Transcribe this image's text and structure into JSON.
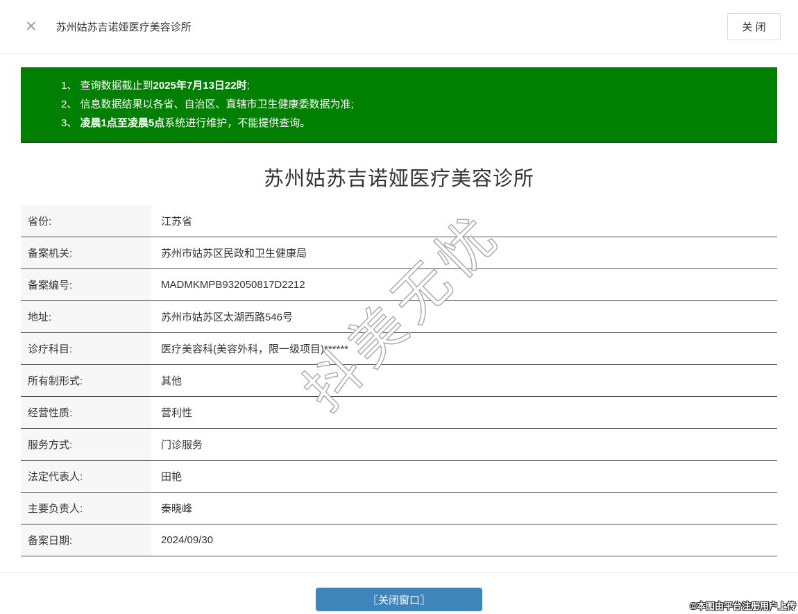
{
  "header": {
    "close_icon": "✕",
    "title": "苏州姑苏吉诺娅医疗美容诊所",
    "close_button_label": "关 闭"
  },
  "notice": {
    "bg_color": "#008000",
    "items": [
      {
        "prefix": "1、",
        "pre": "查询数据截止到",
        "bold": "2025年7月13日22时",
        "post": ";"
      },
      {
        "prefix": "2、",
        "pre": "信息数据结果以各省、自治区、直辖市卫生健康委数据为准;",
        "bold": "",
        "post": ""
      },
      {
        "prefix": "3、",
        "pre": "",
        "bold": "凌晨1点至凌晨5点",
        "post": "系统进行维护，不能提供查询。"
      }
    ]
  },
  "detail": {
    "title": "苏州姑苏吉诺娅医疗美容诊所",
    "separator_color": "#2e5e4e",
    "rows": [
      {
        "label": "省份:",
        "value": "江苏省"
      },
      {
        "label": "备案机关:",
        "value": "苏州市姑苏区民政和卫生健康局"
      },
      {
        "label": "备案编号:",
        "value": "MADMKMPB932050817D2212"
      },
      {
        "label": "地址:",
        "value": "苏州市姑苏区太湖西路546号"
      },
      {
        "label": "诊疗科目:",
        "value": "医疗美容科(美容外科，限一级项目)******"
      },
      {
        "label": "所有制形式:",
        "value": "其他"
      },
      {
        "label": "经营性质:",
        "value": "营利性"
      },
      {
        "label": "服务方式:",
        "value": "门诊服务"
      },
      {
        "label": "法定代表人:",
        "value": "田艳"
      },
      {
        "label": "主要负责人:",
        "value": "秦晓峰"
      },
      {
        "label": "备案日期:",
        "value": "2024/09/30"
      }
    ]
  },
  "footer": {
    "close_window_button": "〖关闭窗口〗",
    "button_color": "#3d85bb"
  },
  "watermarks": {
    "diagonal_text": "抖美无忧",
    "copyright_text": "©本图由平台注册用户上传"
  }
}
